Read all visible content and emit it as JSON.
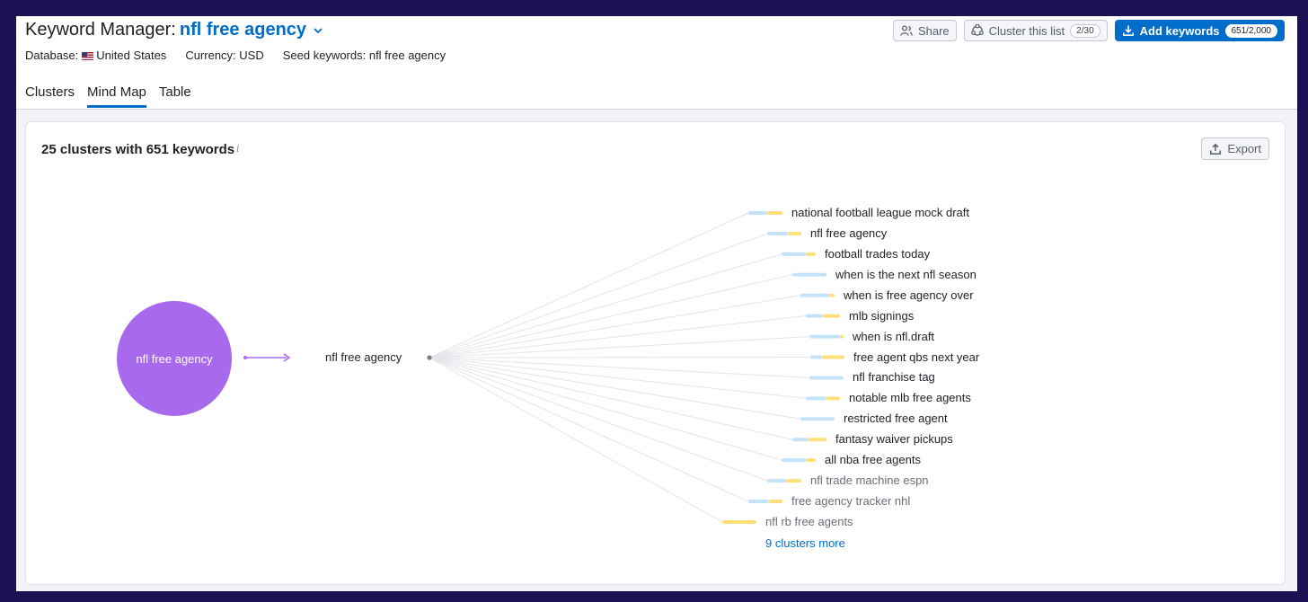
{
  "header": {
    "title_label": "Keyword Manager:",
    "title_keyword": "nfl free agency",
    "database_label": "Database:",
    "database_value": "United States",
    "currency": "Currency: USD",
    "seed_keywords": "Seed keywords: nfl free agency"
  },
  "actions": {
    "share": "Share",
    "cluster": "Cluster this list",
    "cluster_count": "2/30",
    "add": "Add keywords",
    "add_count": "651/2,000"
  },
  "tabs": [
    "Clusters",
    "Mind Map",
    "Table"
  ],
  "active_tab": "Mind Map",
  "panel": {
    "title": "25 clusters with 651 keywords",
    "info_icon": "i",
    "export": "Export"
  },
  "mindmap": {
    "root": "nfl free agency",
    "seed": "nfl free agency",
    "clusters": [
      "national football league mock draft",
      "nfl free agency",
      "football trades today",
      "when is the next nfl season",
      "when is free agency over",
      "mlb signings",
      "when is nfl.draft",
      "free agent qbs next year",
      "nfl franchise tag",
      "notable mlb free agents",
      "restricted free agent",
      "fantasy waiver pickups",
      "all nba free agents",
      "nfl trade machine espn",
      "free agency tracker nhl",
      "nfl rb free agents"
    ],
    "more": "9 clusters more"
  },
  "colors": {
    "accent": "#006dca",
    "bubble": "#a869ec",
    "bar_blue": "#c3e3fb",
    "bar_yellow": "#ffdf7a"
  }
}
